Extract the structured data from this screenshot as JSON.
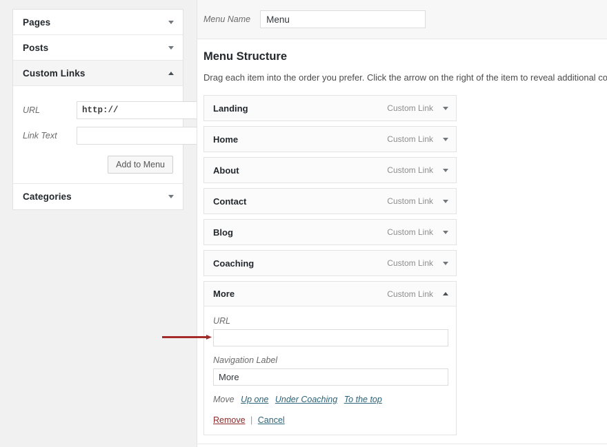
{
  "sidebar": {
    "panels": [
      {
        "label": "Pages",
        "state": "collapsed",
        "icon": "chevron-down-icon"
      },
      {
        "label": "Posts",
        "state": "collapsed",
        "icon": "chevron-down-icon"
      },
      {
        "label": "Custom Links",
        "state": "expanded",
        "icon": "chevron-up-icon"
      }
    ],
    "custom_links": {
      "url_label": "URL",
      "url_value": "http://",
      "link_text_label": "Link Text",
      "link_text_value": "",
      "add_button": "Add to Menu"
    },
    "categories": {
      "label": "Categories",
      "state": "collapsed",
      "icon": "chevron-down-icon"
    }
  },
  "main": {
    "menu_name_label": "Menu Name",
    "menu_name_value": "Menu",
    "structure_title": "Menu Structure",
    "structure_description": "Drag each item into the order you prefer. Click the arrow on the right of the item to reveal additional configuration",
    "item_type_label": "Custom Link",
    "items": [
      {
        "title": "Landing",
        "type": "Custom Link",
        "expanded": false
      },
      {
        "title": "Home",
        "type": "Custom Link",
        "expanded": false
      },
      {
        "title": "About",
        "type": "Custom Link",
        "expanded": false
      },
      {
        "title": "Contact",
        "type": "Custom Link",
        "expanded": false
      },
      {
        "title": "Blog",
        "type": "Custom Link",
        "expanded": false
      },
      {
        "title": "Coaching",
        "type": "Custom Link",
        "expanded": false
      },
      {
        "title": "More",
        "type": "Custom Link",
        "expanded": true
      }
    ],
    "expanded_item": {
      "title": "More",
      "type": "Custom Link",
      "url_label": "URL",
      "url_value": "",
      "nav_label_label": "Navigation Label",
      "nav_label_value": "More",
      "move_label": "Move",
      "move_links": [
        "Up one",
        "Under Coaching",
        "To the top"
      ],
      "remove_label": "Remove",
      "separator": "|",
      "cancel_label": "Cancel"
    }
  },
  "annotation": {
    "type": "arrow",
    "direction": "right",
    "color": "#a52a2a",
    "points_to": "expanded-item-url-input"
  }
}
